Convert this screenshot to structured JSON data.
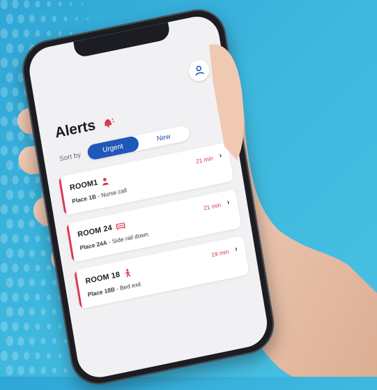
{
  "app": {
    "title": "Alerts",
    "sort_label": "Sort by",
    "sort_options": [
      {
        "label": "Urgent",
        "active": true
      },
      {
        "label": "New",
        "active": false
      }
    ]
  },
  "alerts": [
    {
      "room": "ROOM1",
      "place": "Place 1B",
      "event": "Nurse call",
      "time": "21 min",
      "icon": "person-icon"
    },
    {
      "room": "ROOM 24",
      "place": "Place 24A",
      "event": "Side rail down",
      "time": "21 min",
      "icon": "bed-icon"
    },
    {
      "room": "ROOM 18",
      "place": "Place 18B",
      "event": "Bed exit",
      "time": "19 min",
      "icon": "walking-person-icon"
    }
  ],
  "colors": {
    "accent": "#1f58b8",
    "alert": "#e0344f",
    "background": "#3db7de",
    "screen": "#f1f1f4"
  }
}
